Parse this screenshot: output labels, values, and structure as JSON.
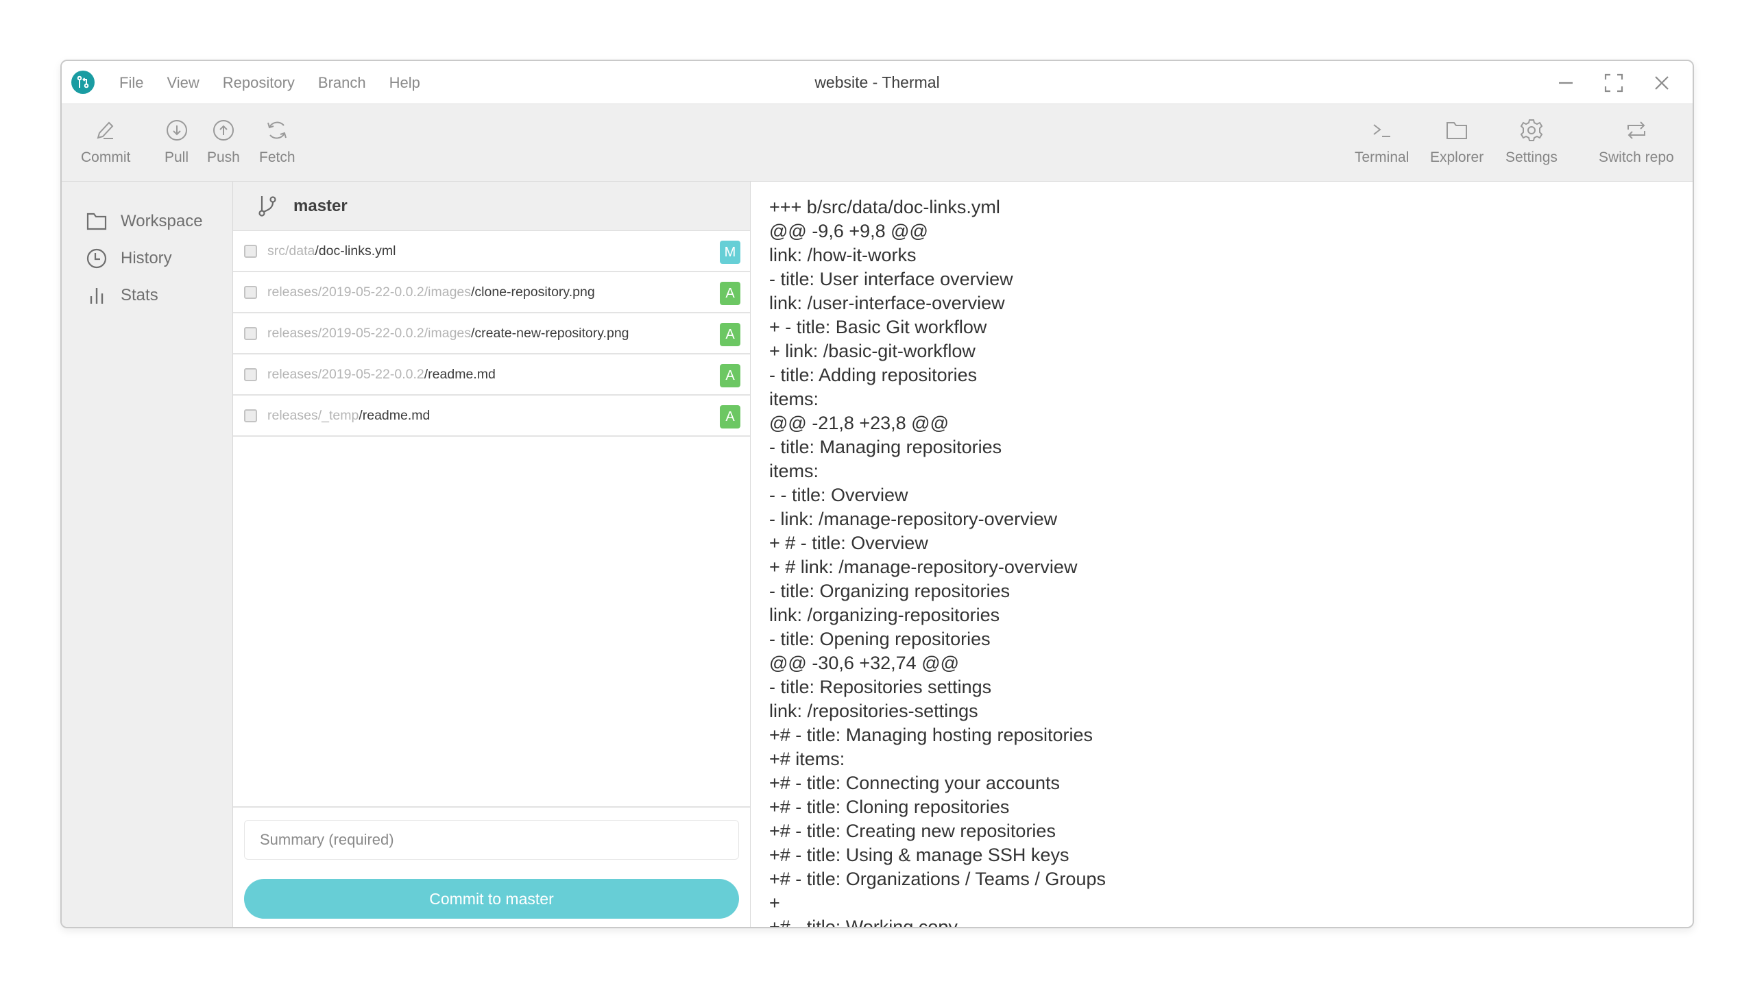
{
  "window": {
    "title": "website - Thermal",
    "menu": [
      "File",
      "View",
      "Repository",
      "Branch",
      "Help"
    ],
    "controls": {
      "minimize": "minimize-icon",
      "maximize": "maximize-icon",
      "close": "close-icon"
    }
  },
  "toolbar": {
    "left": [
      {
        "label": "Commit",
        "icon": "pencil-icon"
      },
      {
        "label": "Pull",
        "icon": "arrow-down-circle-icon"
      },
      {
        "label": "Push",
        "icon": "arrow-up-circle-icon"
      },
      {
        "label": "Fetch",
        "icon": "refresh-icon"
      }
    ],
    "right": [
      {
        "label": "Terminal",
        "icon": "terminal-icon"
      },
      {
        "label": "Explorer",
        "icon": "folder-icon"
      },
      {
        "label": "Settings",
        "icon": "gear-icon"
      },
      {
        "label": "Switch repo",
        "icon": "switch-icon"
      }
    ]
  },
  "sidebar": {
    "items": [
      {
        "label": "Workspace",
        "icon": "folder-icon"
      },
      {
        "label": "History",
        "icon": "clock-icon"
      },
      {
        "label": "Stats",
        "icon": "bar-chart-icon"
      }
    ]
  },
  "changes": {
    "branch": "master",
    "files": [
      {
        "dir": "src/data",
        "name": "/doc-links.yml",
        "status": "M",
        "checked": false
      },
      {
        "dir": "releases/2019-05-22-0.0.2/images",
        "name": "/clone-repository.png",
        "status": "A",
        "checked": false
      },
      {
        "dir": "releases/2019-05-22-0.0.2/images",
        "name": "/create-new-repository.png",
        "status": "A",
        "checked": false
      },
      {
        "dir": "releases/2019-05-22-0.0.2",
        "name": "/readme.md",
        "status": "A",
        "checked": false
      },
      {
        "dir": "releases/_temp",
        "name": "/readme.md",
        "status": "A",
        "checked": false
      }
    ],
    "summary_placeholder": "Summary (required)",
    "summary_value": "",
    "commit_button": "Commit to master"
  },
  "colors": {
    "brand": "#1a9ca2",
    "accent": "#67ced6",
    "modified": "#66cfd6",
    "added": "#6cc763"
  },
  "diff": {
    "lines": [
      "+++ b/src/data/doc-links.yml",
      "@@ -9,6 +9,8 @@",
      "link: /how-it-works",
      "- title: User interface overview",
      "link: /user-interface-overview",
      "+ - title: Basic Git workflow",
      "+ link: /basic-git-workflow",
      "- title: Adding repositories",
      "items:",
      "@@ -21,8 +23,8 @@",
      "- title: Managing repositories",
      "items:",
      "- - title: Overview",
      "- link: /manage-repository-overview",
      "+ # - title: Overview",
      "+ # link: /manage-repository-overview",
      "- title: Organizing repositories",
      "link: /organizing-repositories",
      "- title: Opening repositories",
      "@@ -30,6 +32,74 @@",
      "- title: Repositories settings",
      "link: /repositories-settings",
      "+# - title: Managing hosting repositories",
      "+# items:",
      "+# - title: Connecting your accounts",
      "+# - title: Cloning repositories",
      "+# - title: Creating new repositories",
      "+# - title: Using & manage SSH keys",
      "+# - title: Organizations / Teams / Groups",
      "+",
      "+# - title: Working copy"
    ]
  }
}
